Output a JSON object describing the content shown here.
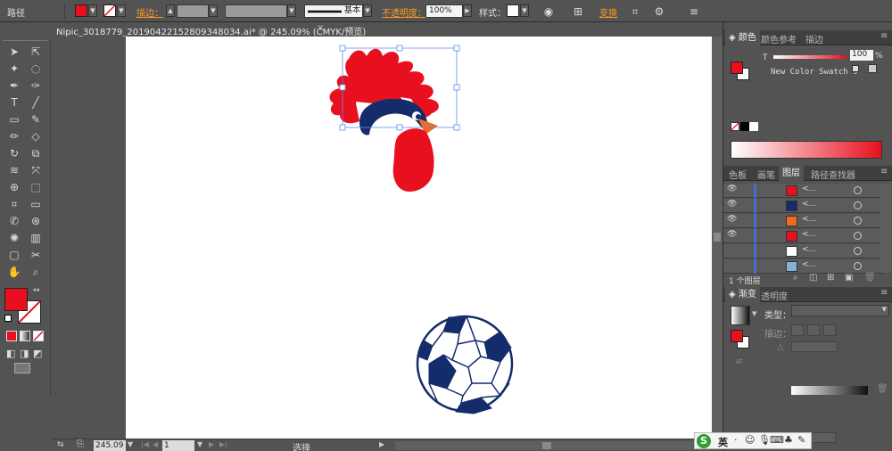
{
  "control_bar": {
    "mode_label": "路径",
    "fill_color": "#e8101e",
    "stroke_label": "描边：",
    "brush_label": "基本",
    "opacity_label": "不透明度：",
    "opacity_value": "100%",
    "style_label": "样式：",
    "transform_label": "变换"
  },
  "document": {
    "tab_title": "Nipic_3018779_20190422152809348034.ai* @ 245.09% (CMYK/预览)",
    "close_glyph": "×"
  },
  "tools": [
    "selection-tool",
    "direct-selection-tool",
    "magic-wand-tool",
    "lasso-tool",
    "pen-tool",
    "curvature-tool",
    "type-tool",
    "line-tool",
    "rectangle-tool",
    "paintbrush-tool",
    "pencil-tool",
    "eraser-tool",
    "rotate-tool",
    "scale-tool",
    "warp-tool",
    "free-transform-tool",
    "shape-builder-tool",
    "perspective-tool",
    "mesh-tool",
    "gradient-tool",
    "eyedropper-tool",
    "blend-tool",
    "symbol-sprayer-tool",
    "column-graph-tool",
    "artboard-tool",
    "slice-tool",
    "hand-tool",
    "zoom-tool"
  ],
  "status": {
    "zoom": "245.09",
    "page": "1",
    "mode": "选择"
  },
  "color_panel": {
    "tabs": [
      "颜色",
      "颜色参考",
      "描边"
    ],
    "t_label": "T",
    "t_value": "100",
    "t_unit": "%",
    "swatch_name": "New Color Swatch 9"
  },
  "layers_panel": {
    "tabs": [
      "色板",
      "画笔",
      "图层",
      "路径查找器"
    ],
    "rows": [
      {
        "name": "<...",
        "visible": true,
        "thumb": "#e8101e",
        "locked_target": true
      },
      {
        "name": "<...",
        "visible": true,
        "thumb": "#142c6b",
        "locked_target": false
      },
      {
        "name": "<...",
        "visible": true,
        "thumb": "#f06a22",
        "locked_target": false
      },
      {
        "name": "<...",
        "visible": true,
        "thumb": "#e8101e",
        "locked_target": false
      },
      {
        "name": "<...",
        "visible": false,
        "thumb": "#ffffff",
        "locked_target": false
      },
      {
        "name": "<...",
        "visible": false,
        "thumb": "#7fb4d6",
        "locked_target": false
      }
    ],
    "footer": "1 个图层"
  },
  "gradient_panel": {
    "tabs": [
      "渐变",
      "透明度"
    ],
    "type_label": "类型：",
    "stroke_label": "描边："
  },
  "ime": {
    "lang": "英"
  }
}
